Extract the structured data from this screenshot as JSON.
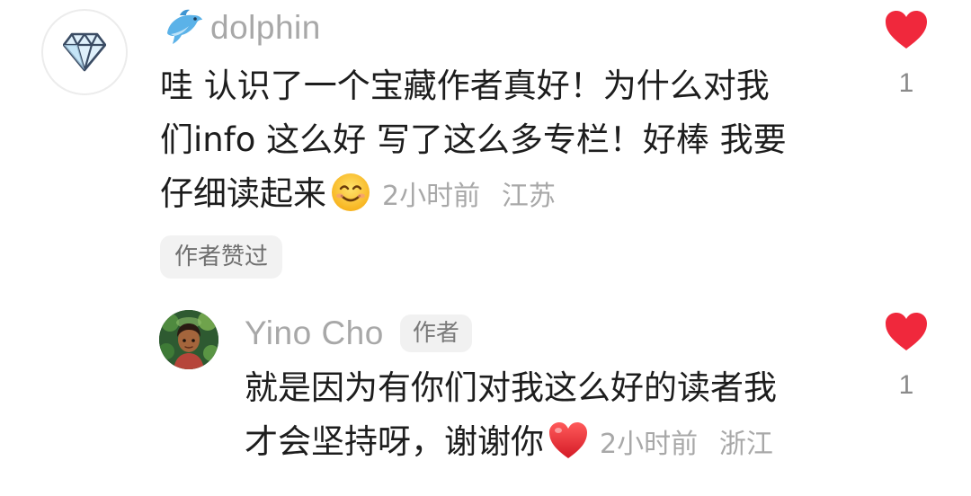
{
  "comment": {
    "username": "dolphin",
    "avatar_icon": "diamond-icon",
    "username_icon": "dolphin-icon",
    "lines": [
      "哇 认识了一个宝藏作者真好！为什么对我",
      "们info 这么好 写了这么多专栏！好棒 我要",
      "仔细读起来"
    ],
    "trailing_emoji": "smiling-face-emoji",
    "time": "2小时前",
    "location": "江苏",
    "badge": "作者赞过",
    "like_count": "1",
    "liked": true
  },
  "reply": {
    "username": "Yino Cho",
    "author_tag": "作者",
    "avatar_icon": "illustrated-portrait-avatar",
    "lines": [
      "就是因为有你们对我这么好的读者我",
      "才会坚持呀，谢谢你"
    ],
    "trailing_emoji": "red-heart-emoji",
    "time": "2小时前",
    "location": "浙江",
    "like_count": "1",
    "liked": true
  },
  "colors": {
    "like_red": "#f0283c",
    "muted_text": "#a8a8a8",
    "tag_bg": "#f1f1f1"
  }
}
